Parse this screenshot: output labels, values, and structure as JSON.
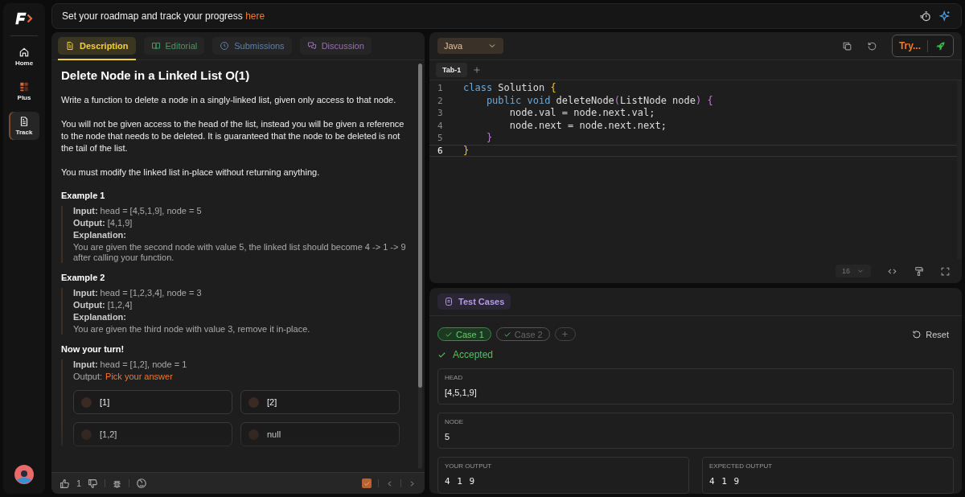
{
  "sidebar": {
    "items": [
      {
        "label": "Home",
        "selected": false
      },
      {
        "label": "Plus",
        "selected": false
      },
      {
        "label": "Track",
        "selected": true
      }
    ]
  },
  "banner": {
    "text": "Set your roadmap and track your progress ",
    "link": "here"
  },
  "problem": {
    "tabs": [
      {
        "label": "Description",
        "color": "#f5cf3c",
        "selected": true
      },
      {
        "label": "Editorial",
        "color": "#3f9e62",
        "selected": false
      },
      {
        "label": "Submissions",
        "color": "#5d7fb0",
        "selected": false
      },
      {
        "label": "Discussion",
        "color": "#9a6fb5",
        "selected": false
      }
    ],
    "title": "Delete Node in a Linked List O(1)",
    "paragraphs": [
      "Write a function to delete a node in a singly-linked list, given only access to that node.",
      "You will not be given access to the head of the list, instead you will be given a reference to the node that needs to be deleted. It is guaranteed that the node to be deleted is not the tail of the list.",
      "You must modify the linked list in-place without returning anything."
    ],
    "examples": [
      {
        "title": "Example 1",
        "rows": [
          {
            "label": "Input:",
            "value": " head = [4,5,1,9], node = 5"
          },
          {
            "label": "Output:",
            "value": " [4,1,9]"
          }
        ],
        "explanation_label": "Explanation:",
        "explanation": "You are given the second node with value 5, the linked list should become 4 -> 1 -> 9 after calling your function."
      },
      {
        "title": "Example 2",
        "rows": [
          {
            "label": "Input:",
            "value": " head = [1,2,3,4], node = 3"
          },
          {
            "label": "Output:",
            "value": " [1,2,4]"
          }
        ],
        "explanation_label": "Explanation:",
        "explanation": "You are given the third node with value 3, remove it in-place."
      }
    ],
    "quiz": {
      "title": "Now your turn!",
      "input_label": "Input:",
      "input": " head = [1,2], node = 1",
      "output_label": "Output:",
      "prompt": "Pick your answer",
      "options": [
        {
          "label": "[1]",
          "selected": false
        },
        {
          "label": "[2]",
          "selected": false
        },
        {
          "label": "[1,2]",
          "selected": false
        },
        {
          "label": "null",
          "selected": false
        }
      ]
    },
    "footer": {
      "likes": "1",
      "solved": true
    }
  },
  "editor": {
    "language": "Java",
    "try_label": "Try...",
    "tabs": [
      {
        "label": "Tab-1",
        "selected": true
      }
    ],
    "lines": [
      {
        "number": "1",
        "current": false,
        "tokens": [
          {
            "kind": "keyword",
            "text": "class"
          },
          {
            "kind": "plain",
            "text": " Solution "
          },
          {
            "kind": "brace1",
            "text": "{"
          }
        ]
      },
      {
        "number": "2",
        "current": false,
        "tokens": [
          {
            "kind": "keyword",
            "text": "    public void"
          },
          {
            "kind": "plain",
            "text": " deleteNode"
          },
          {
            "kind": "brace2",
            "text": "("
          },
          {
            "kind": "plain",
            "text": "ListNode node"
          },
          {
            "kind": "brace2",
            "text": ")"
          },
          {
            "kind": "brace2",
            "text": " {"
          }
        ]
      },
      {
        "number": "3",
        "current": false,
        "tokens": [
          {
            "kind": "plain",
            "text": "        node.val = node.next.val;"
          }
        ]
      },
      {
        "number": "4",
        "current": false,
        "tokens": [
          {
            "kind": "plain",
            "text": "        node.next = node.next.next;"
          }
        ]
      },
      {
        "number": "5",
        "current": false,
        "tokens": [
          {
            "kind": "brace2",
            "text": "    }"
          }
        ]
      },
      {
        "number": "6",
        "current": true,
        "tokens": [
          {
            "kind": "brace1",
            "text": "}"
          }
        ]
      }
    ],
    "font_size": "16"
  },
  "tests": {
    "tab": "Test Cases",
    "reset": "Reset",
    "cases": [
      {
        "label": "Case 1",
        "selected": true,
        "passed": true
      },
      {
        "label": "Case 2",
        "selected": false,
        "passed": true
      }
    ],
    "status": "Accepted",
    "inputs": [
      {
        "label": "HEAD",
        "value": "[4,5,1,9]"
      },
      {
        "label": "NODE",
        "value": "5"
      }
    ],
    "outputs": [
      {
        "label": "YOUR OUTPUT",
        "value": "4 1 9"
      },
      {
        "label": "EXPECTED OUTPUT",
        "value": "4 1 9"
      }
    ]
  }
}
